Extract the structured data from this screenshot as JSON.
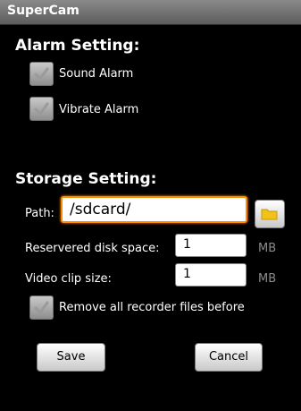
{
  "app": {
    "title": "SuperCam"
  },
  "alarm": {
    "heading": "Alarm Setting:",
    "sound_label": "Sound Alarm",
    "vibrate_label": "Vibrate Alarm",
    "sound_checked": true,
    "vibrate_checked": true
  },
  "storage": {
    "heading": "Storage Setting:",
    "path_label": "Path:",
    "path_value": "/sdcard/",
    "reserved_label": "Reservered disk space:",
    "reserved_value": "1",
    "reserved_unit": "MB",
    "clip_label": "Video clip size:",
    "clip_value": "1",
    "clip_unit": "MB",
    "remove_label": "Remove all recorder files before",
    "remove_checked": true
  },
  "buttons": {
    "save_label": "Save",
    "cancel_label": "Cancel"
  },
  "icons": {
    "folder": "folder-icon",
    "checkmark": "checkmark-icon"
  },
  "colors": {
    "focus": "#ff8a00",
    "folder": "#f2c21a",
    "check": "#9a9a9a"
  }
}
